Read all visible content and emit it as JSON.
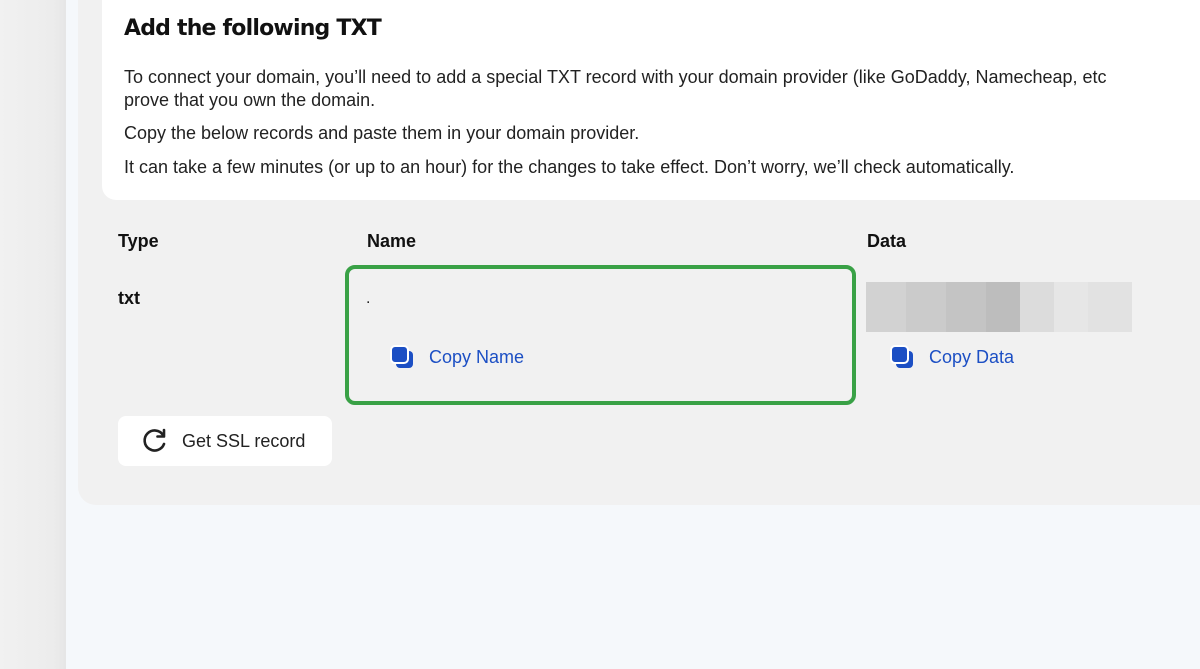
{
  "card": {
    "title": "Add the following TXT",
    "line1": "To connect your domain, you’ll need to add a special TXT record with your domain provider (like GoDaddy, Namecheap, etc",
    "line2": "prove that you own the domain.",
    "line3": "Copy the below records and paste them in your domain provider.",
    "line4": "It can take a few minutes (or up to an hour) for the changes to take effect. Don’t worry, we’ll check automatically."
  },
  "records": {
    "headers": {
      "type": "Type",
      "name": "Name",
      "data": "Data"
    },
    "row": {
      "type": "txt",
      "name": "."
    },
    "copy_name_label": "Copy Name",
    "copy_data_label": "Copy Data"
  },
  "actions": {
    "ssl_label": "Get SSL record"
  },
  "icons": {
    "copy": "copy-icon",
    "refresh": "refresh-icon"
  },
  "colors": {
    "accent": "#1c4fc4",
    "highlight": "#39a146"
  }
}
